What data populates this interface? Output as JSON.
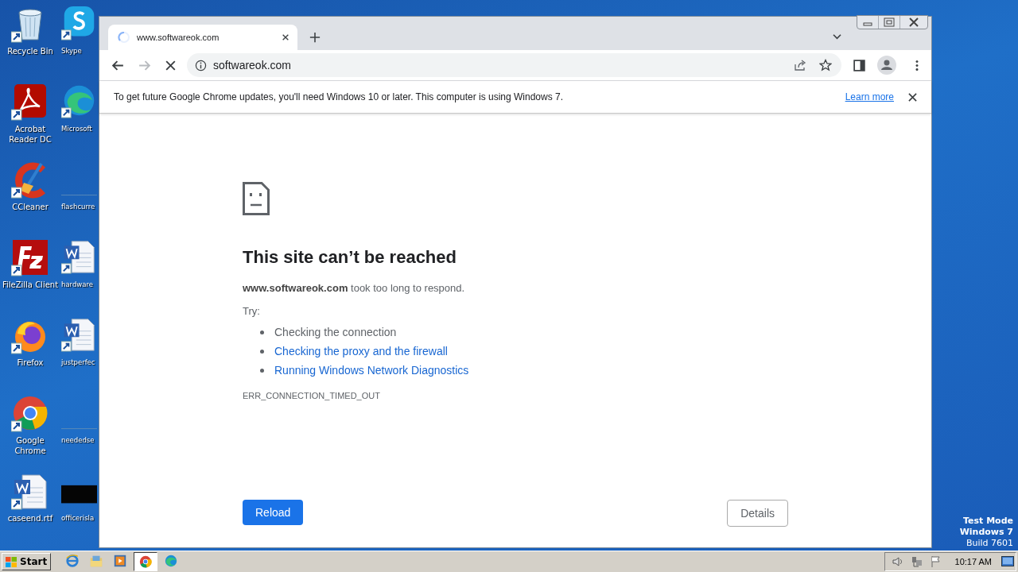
{
  "desktop": {
    "icons": [
      {
        "label": "Recycle Bin",
        "kind": "recycle"
      },
      {
        "label": "Skype",
        "kind": "skype"
      },
      {
        "label": "Acrobat Reader DC",
        "kind": "acrobat"
      },
      {
        "label": "Microsoft",
        "kind": "edge"
      },
      {
        "label": "CCleaner",
        "kind": "ccleaner"
      },
      {
        "label": "flashcurre",
        "kind": "blank"
      },
      {
        "label": "FileZilla Client",
        "kind": "filezilla"
      },
      {
        "label": "hardware",
        "kind": "word"
      },
      {
        "label": "Firefox",
        "kind": "firefox"
      },
      {
        "label": "justperfec",
        "kind": "word"
      },
      {
        "label": "Google Chrome",
        "kind": "chrome"
      },
      {
        "label": "neededse",
        "kind": "blank"
      },
      {
        "label": "caseend.rtf",
        "kind": "word"
      },
      {
        "label": "officerisla",
        "kind": "video"
      }
    ],
    "os_notice": [
      "Test Mode",
      "Windows 7",
      "Build 7601"
    ]
  },
  "browser": {
    "tabs": [
      {
        "title": "www.softwareok.com",
        "selected": true,
        "loading": true
      }
    ],
    "address": "softwareok.com",
    "forward_disabled": true,
    "infobar": {
      "message": "To get future Google Chrome updates, you'll need Windows 10 or later. This computer is using Windows 7.",
      "link": "Learn more"
    },
    "error": {
      "title": "This site can’t be reached",
      "message": "**www.softwareok.com** took too long to respond.",
      "try_label": "Try:",
      "suggestions": [
        {
          "text": "Checking the connection",
          "link": false
        },
        {
          "text": "Checking the proxy and the firewall",
          "link": true
        },
        {
          "text": "Running Windows Network Diagnostics",
          "link": true
        }
      ],
      "code": "ERR_CONNECTION_TIMED_OUT",
      "buttons": [
        {
          "label": "Reload",
          "kind": "primary"
        },
        {
          "label": "Details",
          "kind": "secondary"
        }
      ]
    }
  },
  "taskbar": {
    "start": "Start",
    "apps": [
      {
        "kind": "ie",
        "selected": false
      },
      {
        "kind": "explorer",
        "selected": false
      },
      {
        "kind": "media",
        "selected": false
      },
      {
        "kind": "chrome",
        "selected": true
      },
      {
        "kind": "edge",
        "selected": false
      }
    ],
    "clock": "10:17 AM"
  }
}
